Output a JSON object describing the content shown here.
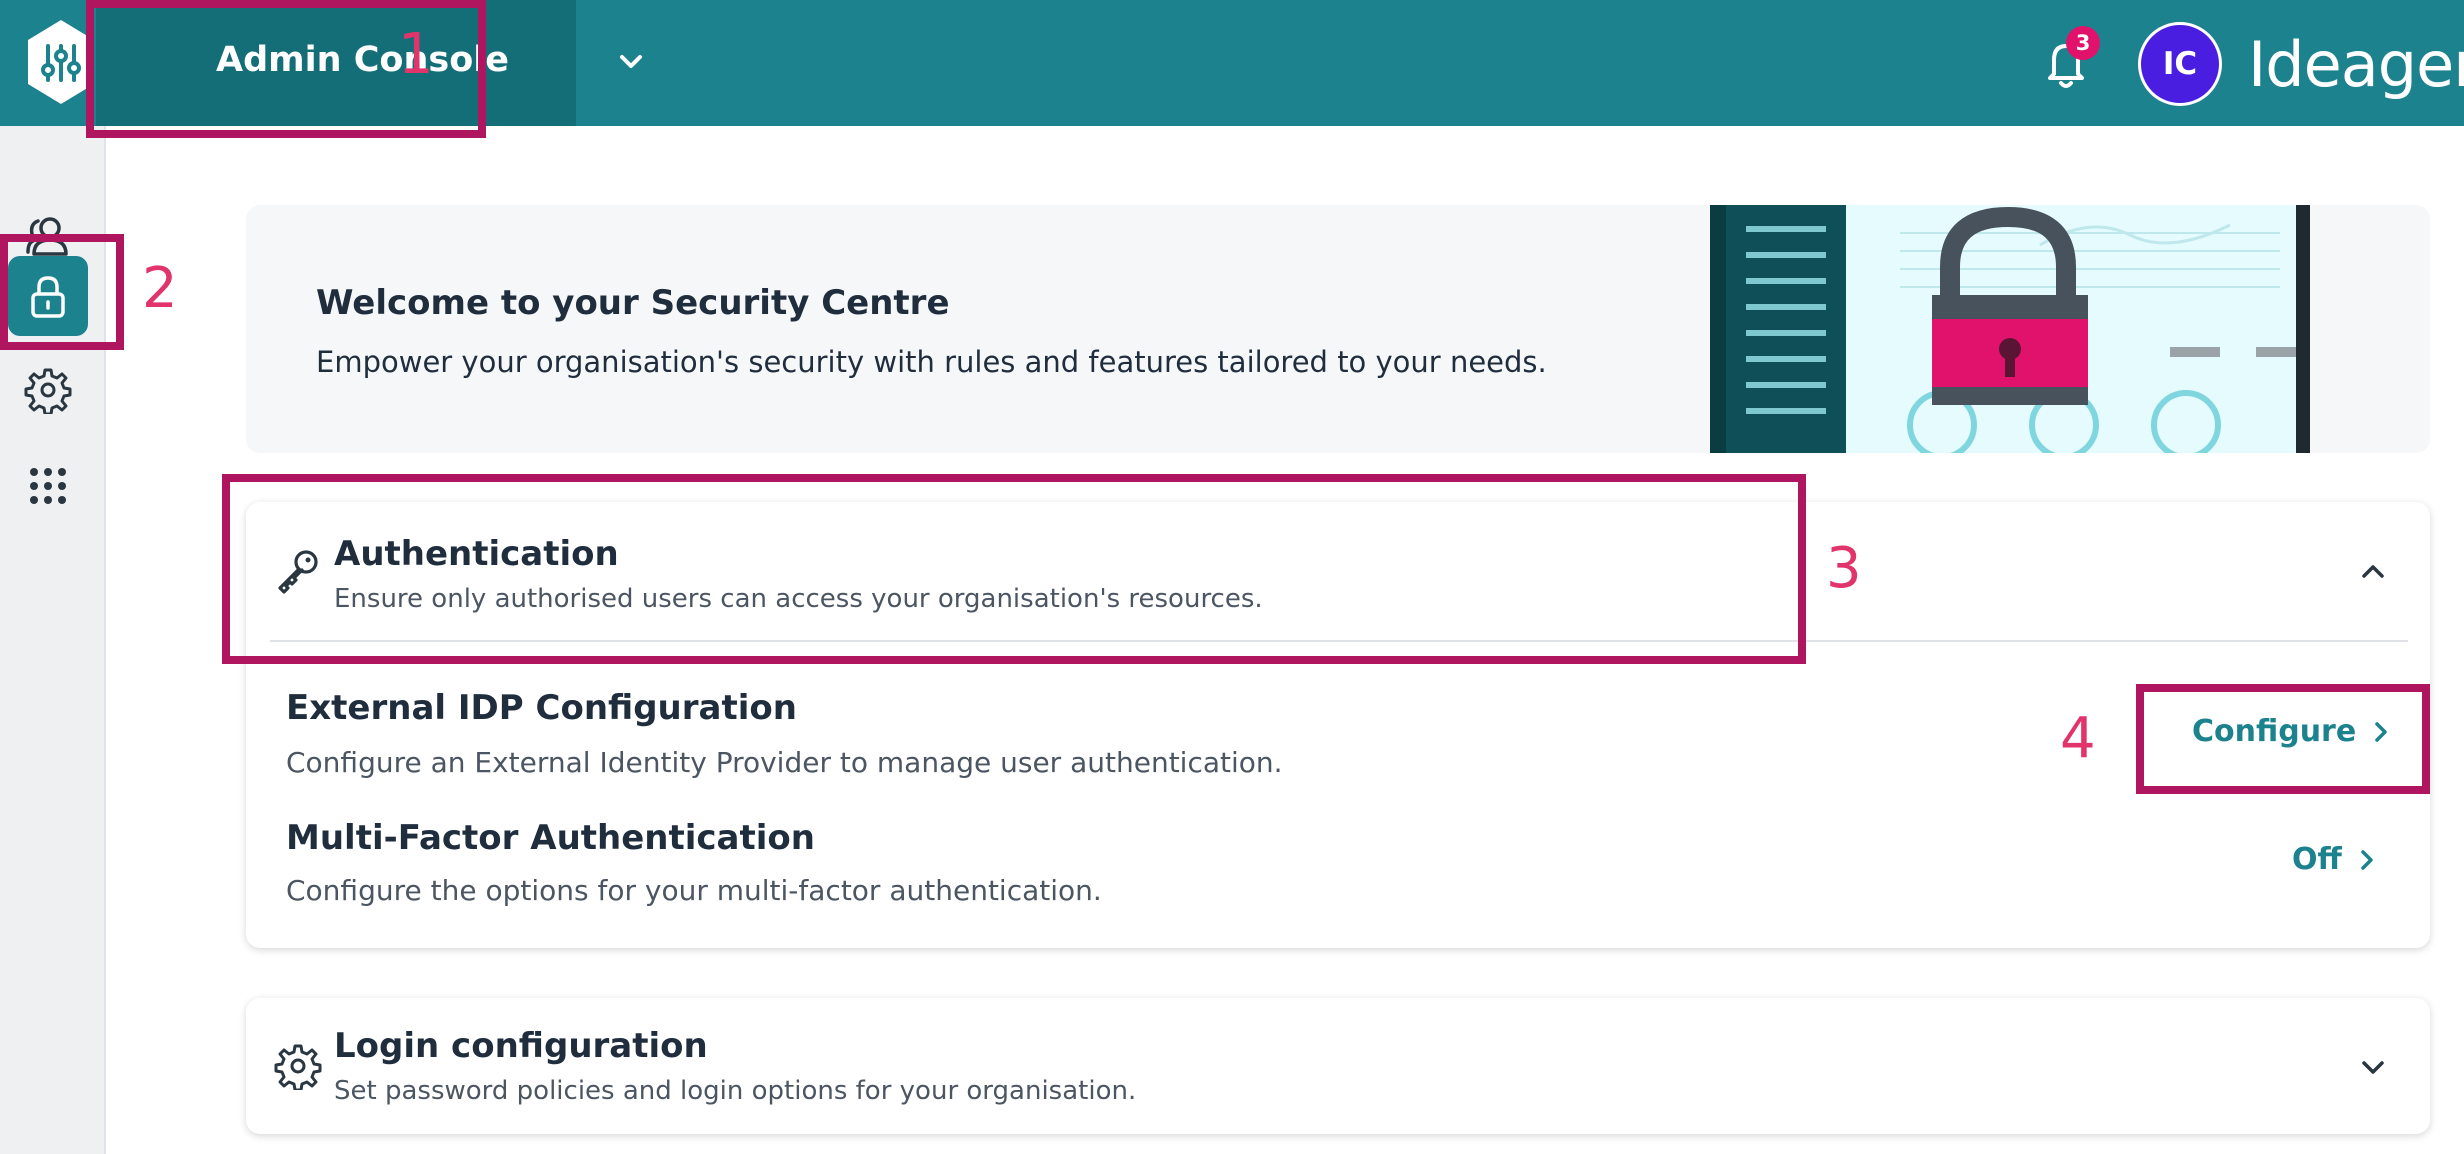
{
  "header": {
    "app_title": "Admin Console",
    "notification_count": "3",
    "avatar_initials": "IC",
    "brand": "Ideagen",
    "bar_color": "#1c828d",
    "badge_color": "#e0126b",
    "avatar_color": "#4a1ee0"
  },
  "sidebar": {
    "items": [
      {
        "icon": "users-icon",
        "active": false
      },
      {
        "icon": "lock-icon",
        "active": true
      },
      {
        "icon": "gear-icon",
        "active": false
      },
      {
        "icon": "apps-grid-icon",
        "active": false
      }
    ]
  },
  "banner": {
    "title": "Welcome to your Security Centre",
    "subtitle": "Empower your organisation's security with rules and features tailored to your needs."
  },
  "authentication": {
    "icon": "key-icon",
    "title": "Authentication",
    "description": "Ensure only authorised users can access your organisation's resources.",
    "expanded": true,
    "rows": [
      {
        "title": "External IDP Configuration",
        "description": "Configure an External Identity Provider to manage user authentication.",
        "action": "Configure"
      },
      {
        "title": "Multi-Factor Authentication",
        "description": "Configure the options for your multi-factor authentication.",
        "action": "Off"
      }
    ]
  },
  "login_configuration": {
    "icon": "gear-icon",
    "title": "Login configuration",
    "description": "Set password policies and login options for your organisation.",
    "expanded": false
  },
  "annotations": [
    "1",
    "2",
    "3",
    "4"
  ],
  "annotation_color": "#b0155f"
}
